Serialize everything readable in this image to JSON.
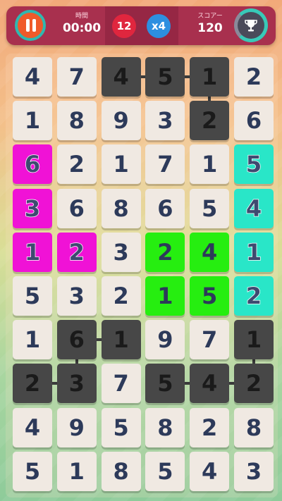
{
  "hud": {
    "time_label": "時間",
    "time_value": "00:00",
    "moves_value": "12",
    "multiplier_value": "x4",
    "score_label": "スコアー",
    "score_value": "120",
    "colors": {
      "hud_bg": "#a8304e",
      "moves_circle": "#e0263e",
      "multiplier_circle": "#2d8fe0"
    }
  },
  "board": {
    "rows": [
      [
        {
          "v": "4",
          "c": "light"
        },
        {
          "v": "7",
          "c": "light"
        },
        {
          "v": "4",
          "c": "dark"
        },
        {
          "v": "5",
          "c": "dark"
        },
        {
          "v": "1",
          "c": "dark"
        },
        {
          "v": "2",
          "c": "light"
        }
      ],
      [
        {
          "v": "1",
          "c": "light"
        },
        {
          "v": "8",
          "c": "light"
        },
        {
          "v": "9",
          "c": "light"
        },
        {
          "v": "3",
          "c": "light"
        },
        {
          "v": "2",
          "c": "dark"
        },
        {
          "v": "6",
          "c": "light"
        }
      ],
      [
        {
          "v": "6",
          "c": "magenta"
        },
        {
          "v": "2",
          "c": "light"
        },
        {
          "v": "1",
          "c": "light"
        },
        {
          "v": "7",
          "c": "light"
        },
        {
          "v": "1",
          "c": "light"
        },
        {
          "v": "5",
          "c": "cyan"
        }
      ],
      [
        {
          "v": "3",
          "c": "magenta"
        },
        {
          "v": "6",
          "c": "light"
        },
        {
          "v": "8",
          "c": "light"
        },
        {
          "v": "6",
          "c": "light"
        },
        {
          "v": "5",
          "c": "light"
        },
        {
          "v": "4",
          "c": "cyan"
        }
      ],
      [
        {
          "v": "1",
          "c": "magenta"
        },
        {
          "v": "2",
          "c": "magenta"
        },
        {
          "v": "3",
          "c": "light"
        },
        {
          "v": "2",
          "c": "green"
        },
        {
          "v": "4",
          "c": "green"
        },
        {
          "v": "1",
          "c": "cyan"
        }
      ],
      [
        {
          "v": "5",
          "c": "light"
        },
        {
          "v": "3",
          "c": "light"
        },
        {
          "v": "2",
          "c": "light"
        },
        {
          "v": "1",
          "c": "green"
        },
        {
          "v": "5",
          "c": "green"
        },
        {
          "v": "2",
          "c": "cyan"
        }
      ],
      [
        {
          "v": "1",
          "c": "light"
        },
        {
          "v": "6",
          "c": "dark"
        },
        {
          "v": "1",
          "c": "dark"
        },
        {
          "v": "9",
          "c": "light"
        },
        {
          "v": "7",
          "c": "light"
        },
        {
          "v": "1",
          "c": "dark"
        }
      ],
      [
        {
          "v": "2",
          "c": "dark"
        },
        {
          "v": "3",
          "c": "dark"
        },
        {
          "v": "7",
          "c": "light"
        },
        {
          "v": "5",
          "c": "dark"
        },
        {
          "v": "4",
          "c": "dark"
        },
        {
          "v": "2",
          "c": "dark"
        }
      ],
      [
        {
          "v": "4",
          "c": "light"
        },
        {
          "v": "9",
          "c": "light"
        },
        {
          "v": "5",
          "c": "light"
        },
        {
          "v": "8",
          "c": "light"
        },
        {
          "v": "2",
          "c": "light"
        },
        {
          "v": "8",
          "c": "light"
        }
      ],
      [
        {
          "v": "5",
          "c": "light"
        },
        {
          "v": "1",
          "c": "light"
        },
        {
          "v": "8",
          "c": "light"
        },
        {
          "v": "5",
          "c": "light"
        },
        {
          "v": "4",
          "c": "light"
        },
        {
          "v": "3",
          "c": "light"
        }
      ]
    ],
    "links": [
      {
        "from": [
          0,
          2
        ],
        "to": [
          0,
          3
        ]
      },
      {
        "from": [
          0,
          3
        ],
        "to": [
          0,
          4
        ]
      },
      {
        "from": [
          0,
          4
        ],
        "to": [
          1,
          4
        ]
      },
      {
        "from": [
          6,
          1
        ],
        "to": [
          6,
          2
        ]
      },
      {
        "from": [
          6,
          1
        ],
        "to": [
          7,
          1
        ]
      },
      {
        "from": [
          7,
          0
        ],
        "to": [
          7,
          1
        ]
      },
      {
        "from": [
          6,
          5
        ],
        "to": [
          7,
          5
        ]
      },
      {
        "from": [
          7,
          3
        ],
        "to": [
          7,
          4
        ]
      },
      {
        "from": [
          7,
          4
        ],
        "to": [
          7,
          5
        ]
      }
    ]
  }
}
